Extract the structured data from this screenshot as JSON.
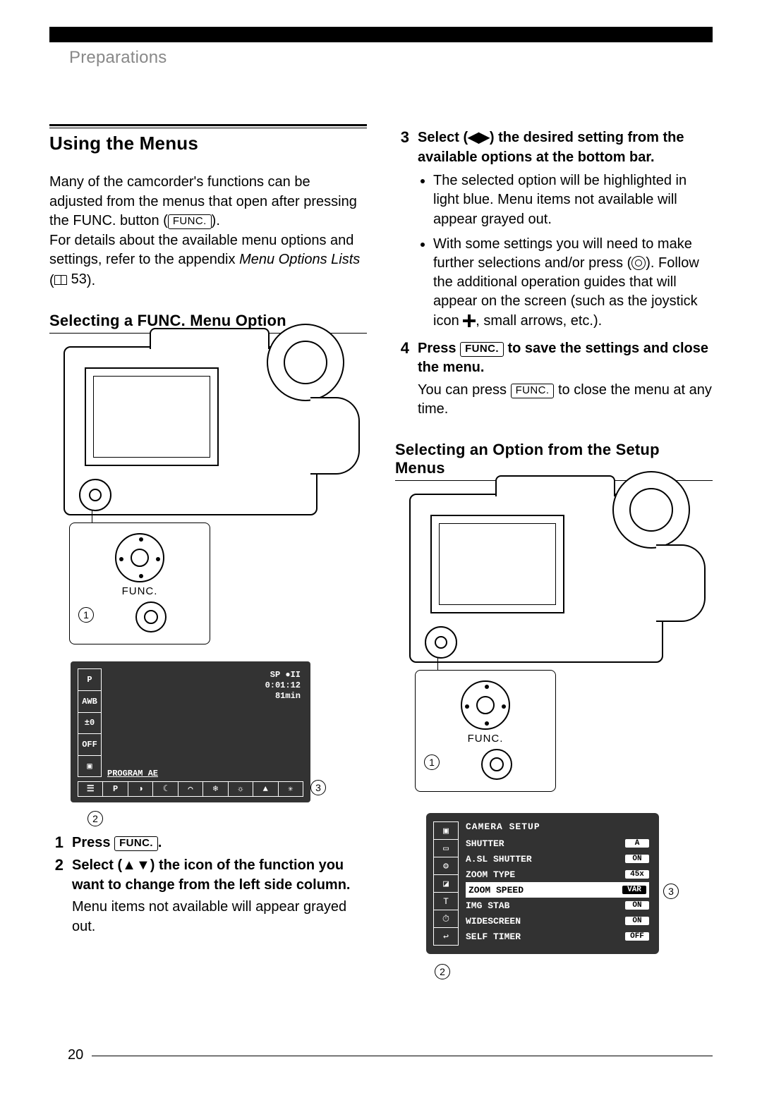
{
  "chapter": "Preparations",
  "page_number": "20",
  "left": {
    "h1": "Using the Menus",
    "intro1": "Many of the camcorder's functions can be adjusted from the menus that open after pressing the FUNC. button (",
    "intro1_key": "FUNC.",
    "intro1_end": ").",
    "intro2a": "For details about the available menu options and settings, refer to the appendix ",
    "intro2_ital": "Menu Options Lists",
    "intro2b": " (",
    "intro2_ref": "53",
    "intro2c": ").",
    "h2": "Selecting a FUNC. Menu Option",
    "func_label": "FUNC.",
    "marker1": "1",
    "osd": {
      "side": [
        "P",
        "AWB",
        "±0",
        "OFF",
        "▣"
      ],
      "info_top": "SP     ●II",
      "info_time": "0:01:12",
      "info_rem": "81min",
      "program_ae": "PROGRAM  AE",
      "bottombar": [
        "☰",
        "P",
        "◑",
        "☾",
        "⌒",
        "❄",
        "☼",
        "▲",
        "✳"
      ]
    },
    "marker2": "2",
    "marker3": "3",
    "step1_num": "1",
    "step1_a": "Press ",
    "step1_key": "FUNC.",
    "step1_b": ".",
    "step2_num": "2",
    "step2_text": "Select (▲▼) the icon of the function you want to change from the left side column.",
    "step2_note": "Menu items not available will appear grayed out."
  },
  "right": {
    "step3_num": "3",
    "step3_text": "Select (◀▶) the desired setting from the available options at the bottom bar.",
    "step3_b1": "The selected option will be highlighted in light blue. Menu items not available will appear grayed out.",
    "step3_b2a": "With some settings you will need to make further selections and/or press (",
    "step3_b2b": "). Follow the additional operation guides that will appear on the screen (such as the joystick icon ",
    "step3_b2c": ", small arrows, etc.).",
    "step4_num": "4",
    "step4_a": "Press ",
    "step4_key": "FUNC.",
    "step4_b": " to save the settings and close the menu.",
    "step4_note_a": "You can press ",
    "step4_note_key": "FUNC.",
    "step4_note_b": " to close the menu at any time.",
    "h2": "Selecting an Option from the Setup Menus",
    "func_label": "FUNC.",
    "marker1": "1",
    "setup": {
      "title": "CAMERA SETUP",
      "rows": [
        {
          "label": "SHUTTER",
          "val": "A"
        },
        {
          "label": "A.SL SHUTTER",
          "val": "ON"
        },
        {
          "label": "ZOOM TYPE",
          "val": "45x"
        },
        {
          "label": "ZOOM SPEED",
          "val": "VAR",
          "sel": true
        },
        {
          "label": "IMG STAB",
          "val": "ON"
        },
        {
          "label": "WIDESCREEN",
          "val": "ON"
        },
        {
          "label": "SELF TIMER",
          "val": "OFF"
        }
      ]
    },
    "marker2": "2",
    "marker3": "3"
  }
}
